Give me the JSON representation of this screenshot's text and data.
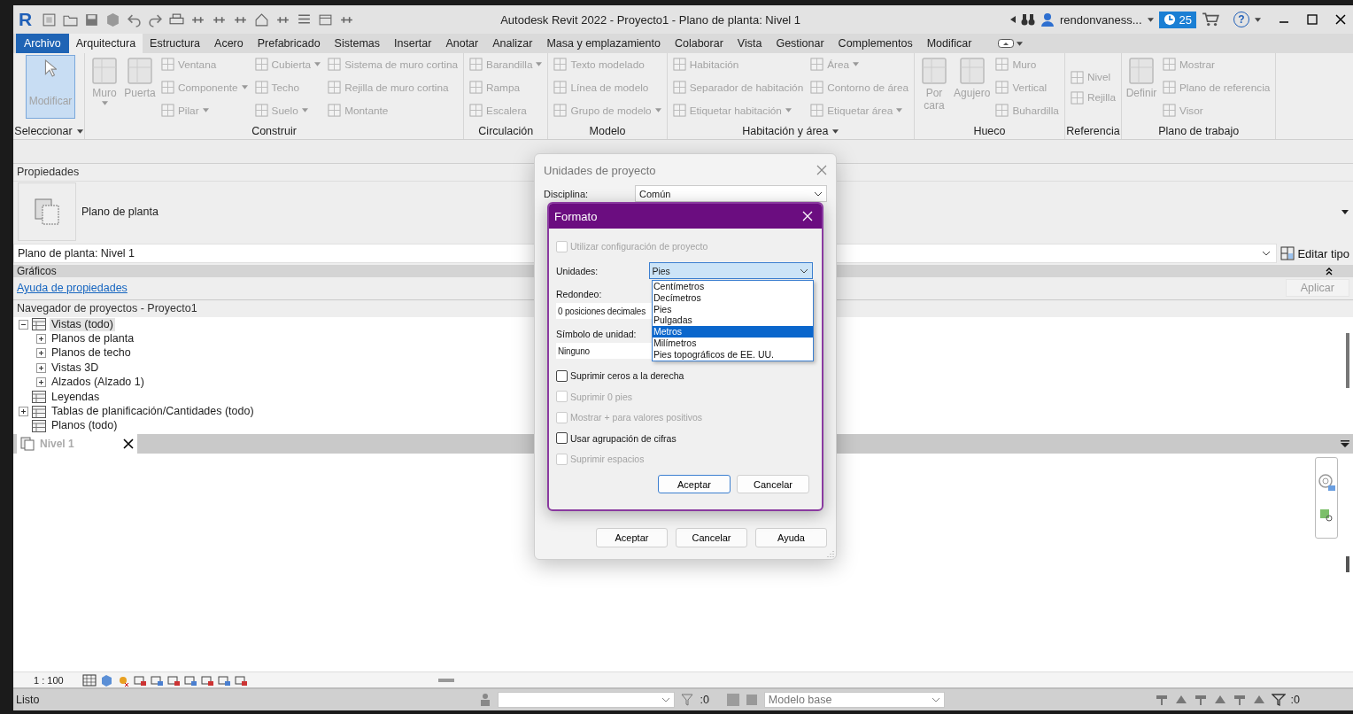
{
  "titlebar": {
    "logo": "R",
    "title": "Autodesk Revit 2022 - Proyecto1 - Plano de planta: Nivel 1",
    "user": "rendonvaness...",
    "trial_days": "25",
    "help_glyph": "?"
  },
  "ribbon_tabs": [
    {
      "label": "Archivo",
      "kind": "file",
      "selected": false
    },
    {
      "label": "Arquitectura",
      "kind": "tab",
      "selected": true
    },
    {
      "label": "Estructura",
      "kind": "tab",
      "selected": false
    },
    {
      "label": "Acero",
      "kind": "tab",
      "selected": false
    },
    {
      "label": "Prefabricado",
      "kind": "tab",
      "selected": false
    },
    {
      "label": "Sistemas",
      "kind": "tab",
      "selected": false
    },
    {
      "label": "Insertar",
      "kind": "tab",
      "selected": false
    },
    {
      "label": "Anotar",
      "kind": "tab",
      "selected": false
    },
    {
      "label": "Analizar",
      "kind": "tab",
      "selected": false
    },
    {
      "label": "Masa y emplazamiento",
      "kind": "tab",
      "selected": false
    },
    {
      "label": "Colaborar",
      "kind": "tab",
      "selected": false
    },
    {
      "label": "Vista",
      "kind": "tab",
      "selected": false
    },
    {
      "label": "Gestionar",
      "kind": "tab",
      "selected": false
    },
    {
      "label": "Complementos",
      "kind": "tab",
      "selected": false
    },
    {
      "label": "Modificar",
      "kind": "tab",
      "selected": false
    }
  ],
  "ribbon_panels": [
    {
      "title": "Seleccionar",
      "menu": true,
      "groups": [
        {
          "kind": "select",
          "label": "Modificar",
          "selected": true,
          "disabled": true
        }
      ]
    },
    {
      "title": "Construir",
      "menu": false,
      "groups": [
        {
          "kind": "large",
          "label": "Muro",
          "dropdown": true,
          "disabled": true
        },
        {
          "kind": "large",
          "label": "Puerta",
          "dropdown": false,
          "disabled": true
        },
        {
          "kind": "column",
          "tools": [
            {
              "label": "Ventana",
              "dropdown": false,
              "disabled": true
            },
            {
              "label": "Componente",
              "dropdown": true,
              "disabled": true
            },
            {
              "label": "Pilar",
              "dropdown": true,
              "disabled": true
            }
          ]
        },
        {
          "kind": "column",
          "tools": [
            {
              "label": "Cubierta",
              "dropdown": true,
              "disabled": true
            },
            {
              "label": "Techo",
              "dropdown": false,
              "disabled": true
            },
            {
              "label": "Suelo",
              "dropdown": true,
              "disabled": true
            }
          ]
        },
        {
          "kind": "column",
          "tools": [
            {
              "label": "Sistema de muro cortina",
              "dropdown": false,
              "disabled": true
            },
            {
              "label": "Rejilla de muro cortina",
              "dropdown": false,
              "disabled": true
            },
            {
              "label": "Montante",
              "dropdown": false,
              "disabled": true
            }
          ]
        }
      ]
    },
    {
      "title": "Circulación",
      "menu": false,
      "groups": [
        {
          "kind": "column",
          "tools": [
            {
              "label": "Barandilla",
              "dropdown": true,
              "disabled": true
            },
            {
              "label": "Rampa",
              "dropdown": false,
              "disabled": true
            },
            {
              "label": "Escalera",
              "dropdown": false,
              "disabled": true
            }
          ]
        }
      ]
    },
    {
      "title": "Modelo",
      "menu": false,
      "groups": [
        {
          "kind": "column",
          "tools": [
            {
              "label": "Texto modelado",
              "dropdown": false,
              "disabled": true
            },
            {
              "label": "Línea de modelo",
              "dropdown": false,
              "disabled": true
            },
            {
              "label": "Grupo de modelo",
              "dropdown": true,
              "disabled": true
            }
          ]
        }
      ]
    },
    {
      "title": "Habitación y área",
      "menu": true,
      "groups": [
        {
          "kind": "column",
          "tools": [
            {
              "label": "Habitación",
              "dropdown": false,
              "disabled": true
            },
            {
              "label": "Separador de habitación",
              "dropdown": false,
              "disabled": true
            },
            {
              "label": "Etiquetar habitación",
              "dropdown": true,
              "disabled": true
            }
          ]
        },
        {
          "kind": "column",
          "tools": [
            {
              "label": "Área",
              "dropdown": true,
              "disabled": true
            },
            {
              "label": "Contorno de área",
              "dropdown": false,
              "disabled": true
            },
            {
              "label": "Etiquetar área",
              "dropdown": true,
              "disabled": true
            }
          ]
        }
      ]
    },
    {
      "title": "Hueco",
      "menu": false,
      "groups": [
        {
          "kind": "large",
          "label": "Por cara",
          "dropdown": false,
          "disabled": true
        },
        {
          "kind": "large",
          "label": "Agujero",
          "dropdown": false,
          "disabled": true
        },
        {
          "kind": "column",
          "tools": [
            {
              "label": "Muro",
              "dropdown": false,
              "disabled": true
            },
            {
              "label": "Vertical",
              "dropdown": false,
              "disabled": true
            },
            {
              "label": "Buhardilla",
              "dropdown": false,
              "disabled": true
            }
          ]
        }
      ]
    },
    {
      "title": "Referencia",
      "menu": false,
      "groups": [
        {
          "kind": "column",
          "tools": [
            {
              "label": "Nivel",
              "dropdown": false,
              "disabled": true
            },
            {
              "label": "Rejilla",
              "dropdown": false,
              "disabled": true
            }
          ]
        }
      ]
    },
    {
      "title": "Plano de trabajo",
      "menu": false,
      "groups": [
        {
          "kind": "large",
          "label": "Definir",
          "dropdown": false,
          "disabled": true
        },
        {
          "kind": "column",
          "tools": [
            {
              "label": "Mostrar",
              "dropdown": false,
              "disabled": true
            },
            {
              "label": "Plano de referencia",
              "dropdown": false,
              "disabled": true
            },
            {
              "label": "Visor",
              "dropdown": false,
              "disabled": true
            }
          ]
        }
      ]
    }
  ],
  "properties": {
    "title": "Propiedades",
    "type_name": "Plano de planta",
    "instance": "Plano de planta: Nivel 1",
    "edit_type": "Editar tipo",
    "group": "Gráficos",
    "help_link": "Ayuda de propiedades",
    "apply": "Aplicar",
    "apply_disabled": true
  },
  "project_browser": {
    "title": "Navegador de proyectos - Proyecto1",
    "tree": [
      {
        "label": "Vistas (todo)",
        "kind": "folder",
        "expanded": true,
        "selected": true,
        "children": [
          {
            "label": "Planos de planta",
            "kind": "folder",
            "expanded": false,
            "selected": false
          },
          {
            "label": "Planos de techo",
            "kind": "folder",
            "expanded": false,
            "selected": false
          },
          {
            "label": "Vistas 3D",
            "kind": "folder",
            "expanded": false,
            "selected": false
          },
          {
            "label": "Alzados (Alzado 1)",
            "kind": "folder",
            "expanded": false,
            "selected": false
          }
        ]
      },
      {
        "label": "Leyendas",
        "kind": "leaf",
        "selected": false
      },
      {
        "label": "Tablas de planificación/Cantidades (todo)",
        "kind": "folder",
        "expanded": false,
        "selected": false
      },
      {
        "label": "Planos (todo)",
        "kind": "leaf",
        "selected": false
      }
    ]
  },
  "view_tabs": [
    {
      "label": "Nivel 1",
      "selected": false
    }
  ],
  "view_bar": {
    "scale": "1 : 100"
  },
  "status_bar": {
    "text": "Listo",
    "selection_count": ":0",
    "model": "Modelo base",
    "filter_count": ":0"
  },
  "units_dialog": {
    "title": "Unidades de proyecto",
    "discipline_label": "Disciplina:",
    "discipline": "Común",
    "buttons": [
      "Aceptar",
      "Cancelar",
      "Ayuda"
    ]
  },
  "format_dialog": {
    "title": "Formato",
    "use_project": {
      "label": "Utilizar configuración de proyecto",
      "checked": false,
      "disabled": true
    },
    "units_label": "Unidades:",
    "units_value": "Pies",
    "units_options": [
      {
        "label": "Centímetros",
        "selected": false
      },
      {
        "label": "Decímetros",
        "selected": false
      },
      {
        "label": "Pies",
        "selected": false
      },
      {
        "label": "Pulgadas",
        "selected": false
      },
      {
        "label": "Metros",
        "selected": true
      },
      {
        "label": "Milímetros",
        "selected": false
      },
      {
        "label": "Pies topográficos de EE. UU.",
        "selected": false
      }
    ],
    "rounding_label": "Redondeo:",
    "rounding_value": "0 posiciones decimales",
    "symbol_label": "Símbolo de unidad:",
    "symbol_value": "Ninguno",
    "options": [
      {
        "label": "Suprimir ceros a la derecha",
        "checked": false,
        "disabled": false
      },
      {
        "label": "Suprimir 0 pies",
        "checked": false,
        "disabled": true
      },
      {
        "label": "Mostrar + para valores positivos",
        "checked": false,
        "disabled": true
      },
      {
        "label": "Usar agrupación de cifras",
        "checked": false,
        "disabled": false
      },
      {
        "label": "Suprimir espacios",
        "checked": false,
        "disabled": true
      }
    ],
    "buttons": [
      {
        "label": "Aceptar",
        "default": true
      },
      {
        "label": "Cancelar",
        "default": false
      }
    ]
  }
}
